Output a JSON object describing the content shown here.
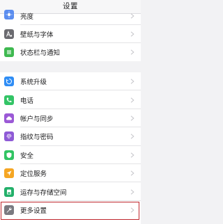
{
  "header": {
    "title": "设置"
  },
  "group1": {
    "items": [
      {
        "label": "亮度",
        "icon": "brightness-icon",
        "color": "#5b8def"
      },
      {
        "label": "壁纸与字体",
        "icon": "wallpaper-font-icon",
        "color": "#6b6b70"
      },
      {
        "label": "状态栏与通知",
        "icon": "notification-icon",
        "color": "#3fb950"
      }
    ]
  },
  "group2": {
    "items": [
      {
        "label": "系统升级",
        "icon": "system-update-icon",
        "color": "#2f8df5"
      },
      {
        "label": "电话",
        "icon": "phone-icon",
        "color": "#33c466"
      },
      {
        "label": "帐户与同步",
        "icon": "account-sync-icon",
        "color": "#9b59d6"
      },
      {
        "label": "指纹与密码",
        "icon": "fingerprint-icon",
        "color": "#8e5ad6"
      },
      {
        "label": "安全",
        "icon": "security-icon",
        "color": "#31c463"
      },
      {
        "label": "定位服务",
        "icon": "location-icon",
        "color": "#f5a623"
      },
      {
        "label": "运存与存储空间",
        "icon": "storage-icon",
        "color": "#23b06a"
      },
      {
        "label": "更多设置",
        "icon": "more-settings-icon",
        "color": "#7a7a80"
      }
    ]
  },
  "highlight_color": "#c0282e"
}
